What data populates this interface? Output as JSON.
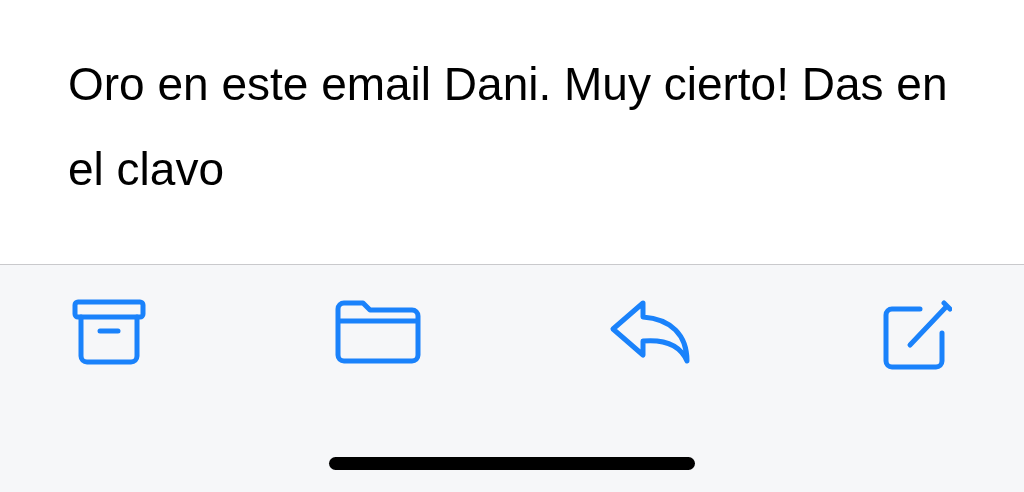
{
  "message": {
    "body": "Oro en este email Dani. Muy cierto! Das en el clavo"
  },
  "toolbar": [
    {
      "kind": "archive"
    },
    {
      "kind": "folder"
    },
    {
      "kind": "reply"
    },
    {
      "kind": "compose"
    }
  ]
}
